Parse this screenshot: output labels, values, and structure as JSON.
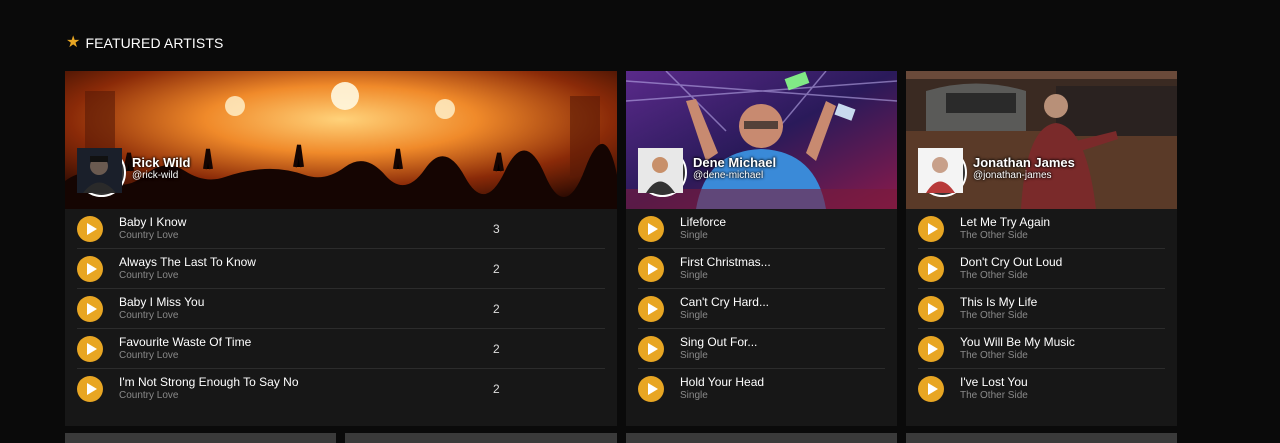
{
  "section": {
    "icon": "star-icon",
    "title": "FEATURED ARTISTS",
    "accent_color": "#e8a623"
  },
  "artists": [
    {
      "name": "Rick Wild",
      "handle": "@rick-wild",
      "tracks": [
        {
          "title": "Baby I Know",
          "album": "Country Love",
          "count": "3"
        },
        {
          "title": "Always The Last To Know",
          "album": "Country Love",
          "count": "2"
        },
        {
          "title": "Baby I Miss You",
          "album": "Country Love",
          "count": "2"
        },
        {
          "title": "Favourite Waste Of Time",
          "album": "Country Love",
          "count": "2"
        },
        {
          "title": "I'm Not Strong Enough To Say No",
          "album": "Country Love",
          "count": "2"
        }
      ]
    },
    {
      "name": "Dene Michael",
      "handle": "@dene-michael",
      "tracks": [
        {
          "title": "Lifeforce",
          "album": "Single"
        },
        {
          "title": "First Christmas...",
          "album": "Single"
        },
        {
          "title": "Can't Cry Hard...",
          "album": "Single"
        },
        {
          "title": "Sing Out For...",
          "album": "Single"
        },
        {
          "title": "Hold Your Head",
          "album": "Single"
        }
      ]
    },
    {
      "name": "Jonathan James",
      "handle": "@jonathan-james",
      "tracks": [
        {
          "title": "Let Me Try Again",
          "album": "The Other Side"
        },
        {
          "title": "Don't Cry Out Loud",
          "album": "The Other Side"
        },
        {
          "title": "This Is My Life",
          "album": "The Other Side"
        },
        {
          "title": "You Will Be My Music",
          "album": "The Other Side"
        },
        {
          "title": "I've Lost You",
          "album": "The Other Side"
        }
      ]
    }
  ]
}
